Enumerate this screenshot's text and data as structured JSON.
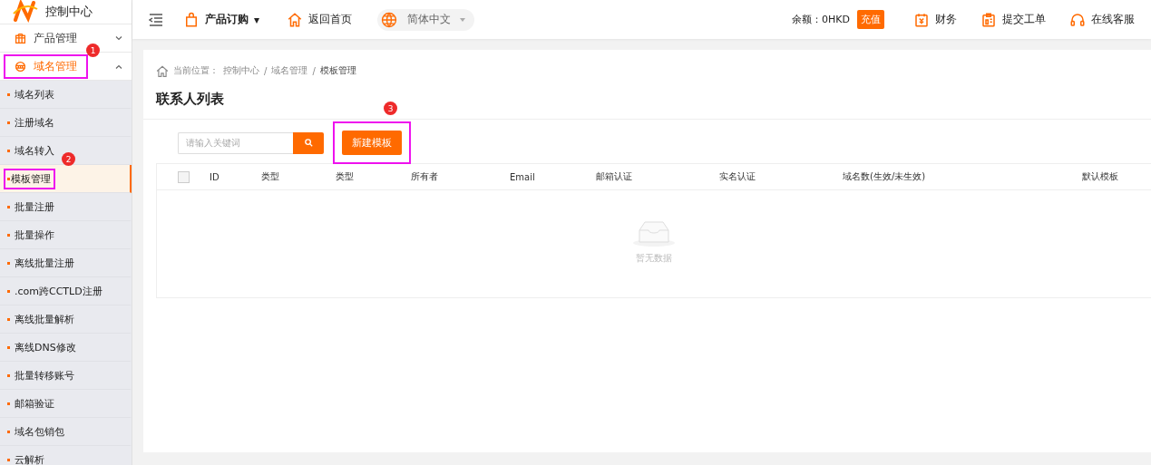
{
  "logo": {
    "title": "控制中心"
  },
  "header": {
    "product_menu": "产品订购",
    "caret": "▾",
    "home": "返回首页",
    "language": "简体中文",
    "balance": "余额：0HKD",
    "recharge": "充值",
    "links": [
      {
        "kind": "finance",
        "label": "财务"
      },
      {
        "kind": "ticket",
        "label": "提交工单"
      },
      {
        "kind": "support",
        "label": "在线客服"
      }
    ]
  },
  "sidebar": {
    "groups": [
      {
        "kind": "product",
        "label": "产品管理",
        "expanded": false,
        "active": false
      },
      {
        "kind": "domain",
        "label": "域名管理",
        "expanded": true,
        "active": true,
        "annotation": "1",
        "children": [
          {
            "label": "域名列表",
            "selected": false
          },
          {
            "label": "注册域名",
            "selected": false
          },
          {
            "label": "域名转入",
            "selected": false
          },
          {
            "label": "模板管理",
            "selected": true,
            "annotation": "2"
          },
          {
            "label": "批量注册",
            "selected": false
          },
          {
            "label": "批量操作",
            "selected": false
          },
          {
            "label": "离线批量注册",
            "selected": false
          },
          {
            "label": ".com跨CCTLD注册",
            "selected": false
          },
          {
            "label": "离线批量解析",
            "selected": false
          },
          {
            "label": "离线DNS修改",
            "selected": false
          },
          {
            "label": "批量转移账号",
            "selected": false
          },
          {
            "label": "邮箱验证",
            "selected": false
          },
          {
            "label": "域名包销包",
            "selected": false
          },
          {
            "label": "云解析",
            "selected": false
          }
        ]
      }
    ]
  },
  "breadcrumb": {
    "prefix": "当前位置：",
    "items": [
      "控制中心",
      "域名管理",
      "模板管理"
    ],
    "separator": "/"
  },
  "page_title": "联系人列表",
  "search": {
    "placeholder": "请输入关键词"
  },
  "new_button": {
    "label": "新建模板",
    "annotation": "3"
  },
  "table": {
    "select_all": {
      "checked": false
    },
    "columns": [
      "ID",
      "类型",
      "类型",
      "所有者",
      "Email",
      "邮箱认证",
      "实名认证",
      "域名数(生效/未生效)",
      "默认模板"
    ],
    "empty_text": "暂无数据"
  }
}
